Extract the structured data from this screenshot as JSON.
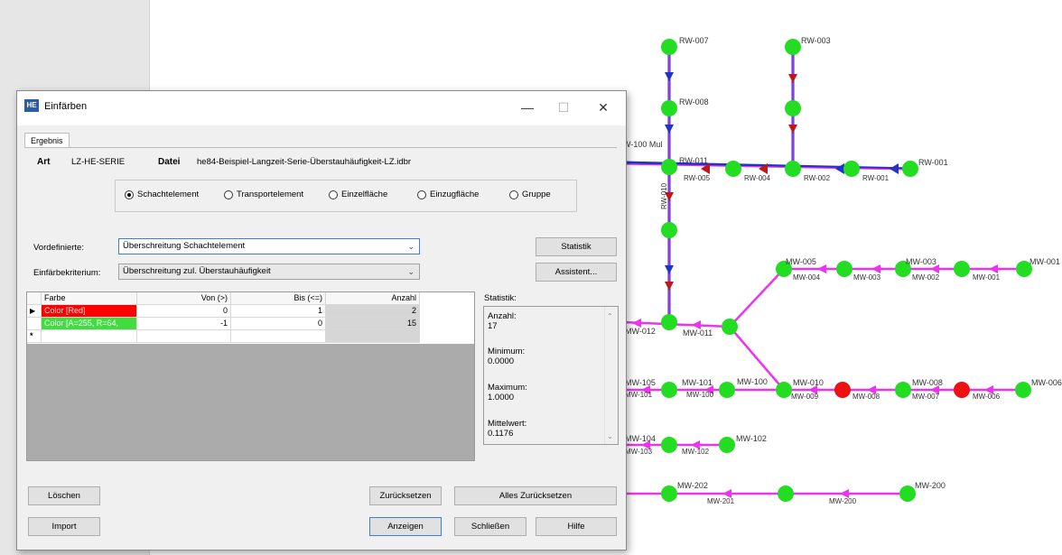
{
  "network": {
    "nodes_rw": [
      "RW-007",
      "RW-003",
      "RW-008",
      "RW-011",
      "RW-001",
      "W-100 Mul"
    ],
    "pipes_rw": [
      "RW-010",
      "RW-005",
      "RW-004",
      "RW-002",
      "RW-001"
    ],
    "nodes_mw": [
      "MW-005",
      "MW-003",
      "MW-001",
      "MW-012",
      "MW-011",
      "MW-105",
      "MW-101",
      "MW-100",
      "MW-010",
      "MW-008",
      "MW-006",
      "MW-104",
      "MW-102",
      "MW-202",
      "MW-200"
    ],
    "pipes_mw": [
      "MW-004",
      "MW-003",
      "MW-002",
      "MW-001",
      "MW-101",
      "MW-100",
      "MW-009",
      "MW-008",
      "MW-007",
      "MW-006",
      "MW-103",
      "MW-102",
      "MW-201",
      "MW-200"
    ],
    "colors": {
      "node_ok": "#22dd22",
      "node_exceed": "#ee1111",
      "pipe_rw": "#2233cc",
      "pipe_mw": "#ee33ee",
      "arrow_rw": "#c01818"
    }
  },
  "dialog": {
    "title": "Einfärben",
    "app_icon": "HE",
    "window_controls": {
      "minimize": "—",
      "maximize": "☐",
      "close": "✕"
    },
    "tab": "Ergebnis",
    "art_label": "Art",
    "art_value": "LZ-HE-SERIE",
    "datei_label": "Datei",
    "datei_value": "he84-Beispiel-Langzeit-Serie-Überstauhäufigkeit-LZ.idbr",
    "radio_options": [
      {
        "label": "Schachtelement",
        "selected": true
      },
      {
        "label": "Transportelement",
        "selected": false
      },
      {
        "label": "Einzelfläche",
        "selected": false
      },
      {
        "label": "Einzugfläche",
        "selected": false
      },
      {
        "label": "Gruppe",
        "selected": false
      }
    ],
    "vordefinierte_label": "Vordefinierte:",
    "vordefinierte_value": "Überschreitung Schachtelement",
    "kriterium_label": "Einfärbekriterium:",
    "kriterium_value": "Überschreitung zul. Überstauhäufigkeit",
    "statistik_button": "Statistik",
    "assistent_button": "Assistent...",
    "grid": {
      "headers": [
        "Farbe",
        "Von (>)",
        "Bis (<=)",
        "Anzahl"
      ],
      "rows": [
        {
          "farbe": "Color [Red]",
          "von": "0",
          "bis": "1",
          "anzahl": "2",
          "color": "#ff0000"
        },
        {
          "farbe": "Color [A=255, R=64,",
          "von": "-1",
          "bis": "0",
          "anzahl": "15",
          "color": "#40dd40"
        }
      ],
      "new_row_marker": "*",
      "current_row_marker": "▶"
    },
    "statistics": {
      "label": "Statistik:",
      "anzahl_label": "Anzahl:",
      "anzahl": "17",
      "minimum_label": "Minimum:",
      "minimum": "0.0000",
      "maximum_label": "Maximum:",
      "maximum": "1.0000",
      "mittelwert_label": "Mittelwert:",
      "mittelwert": "0.1176"
    },
    "buttons": {
      "loeschen": "Löschen",
      "zuruecksetzen": "Zurücksetzen",
      "alles_zuruecksetzen": "Alles Zurücksetzen",
      "import": "Import",
      "anzeigen": "Anzeigen",
      "schliessen": "Schließen",
      "hilfe": "Hilfe"
    }
  }
}
